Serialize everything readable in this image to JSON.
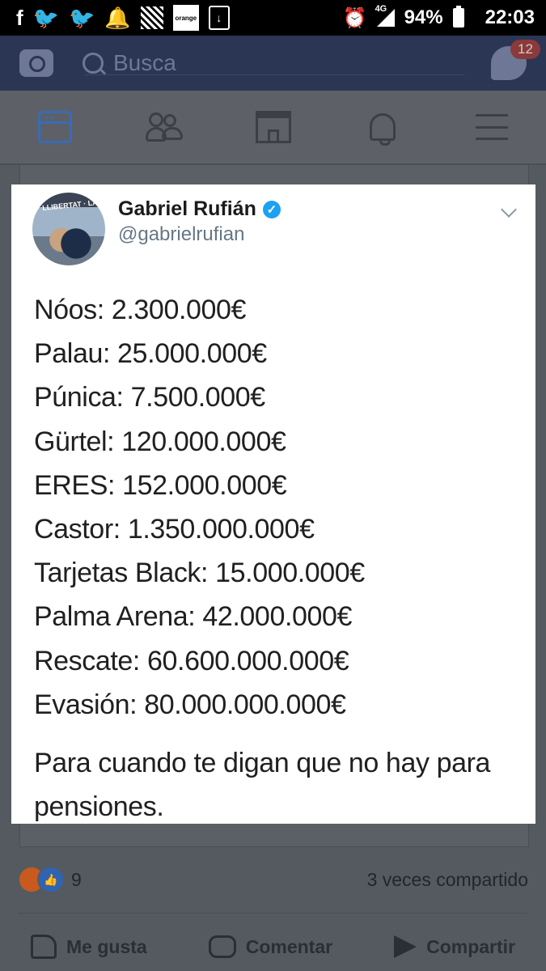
{
  "status_bar": {
    "icons_left": [
      "facebook-icon",
      "twitter-icon",
      "twitter-icon",
      "notification-bell-icon",
      "pixel-image-icon",
      "orange-carrier-icon",
      "download-icon"
    ],
    "orange_label": "orange",
    "network": "4G",
    "battery": "94%",
    "time": "22:03"
  },
  "fb_header": {
    "search_placeholder": "Busca",
    "messenger_badge": "12"
  },
  "nav": [
    "news-feed",
    "friends",
    "marketplace",
    "notifications",
    "menu"
  ],
  "tweet": {
    "name": "Gabriel Rufián",
    "handle": "@gabrielrufian",
    "avatar_banner": "LLIBERTAT · LA DEMOCRA",
    "lines": [
      "Nóos: 2.300.000€",
      "Palau: 25.000.000€",
      "Púnica: 7.500.000€",
      "Gürtel: 120.000.000€",
      "ERES: 152.000.000€",
      "Castor: 1.350.000.000€",
      "Tarjetas Black: 15.000.000€",
      "Palma Arena: 42.000.000€",
      "Rescate: 60.600.000.000€",
      "Evasión: 80.000.000.000€"
    ],
    "footer": "Para cuando te digan que no hay para pensiones."
  },
  "reactions": {
    "count": "9",
    "shares": "3 veces compartido"
  },
  "actions": {
    "like": "Me gusta",
    "comment": "Comentar",
    "share": "Compartir"
  },
  "colors": {
    "fb_header": "#2b3654",
    "active_nav": "#3a6bb6",
    "verified": "#1da1f2"
  }
}
